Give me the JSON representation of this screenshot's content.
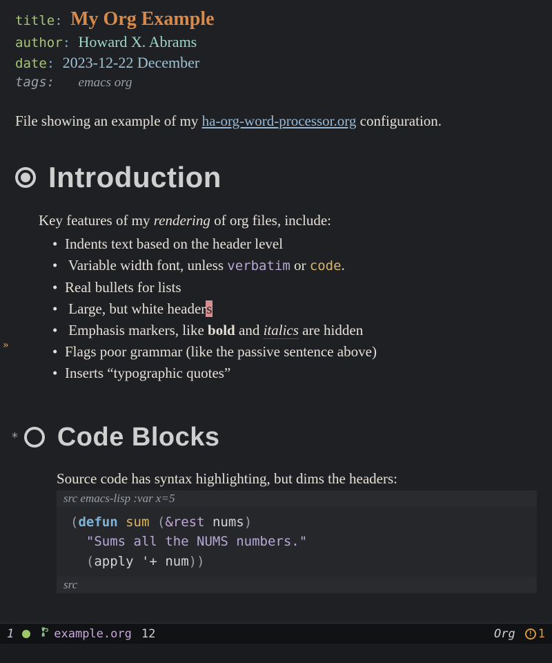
{
  "meta": {
    "title_key": "title",
    "title_val": "My Org Example",
    "author_key": "author",
    "author_val": "Howard X. Abrams",
    "date_key": "date",
    "date_val": "2023-12-22 December",
    "tags_key": "tags:",
    "tags_val": "emacs org"
  },
  "intro": {
    "pre": "File showing an example of my ",
    "link": "ha-org-word-processor.org",
    "post": " configuration."
  },
  "h1a": "Introduction",
  "lead": {
    "pre": "Key features of my ",
    "em": "rendering",
    "post": " of org files, include:"
  },
  "features": {
    "f0": "Indents text based on the header level",
    "f1_pre": "Variable width font, unless ",
    "f1_verbatim": "verbatim",
    "f1_mid": " or ",
    "f1_code": "code",
    "f1_post": ".",
    "f2": "Real bullets for lists",
    "f3_pre": "Large, but white header",
    "f3_cursor": "s",
    "f4_pre": "Emphasis markers, like ",
    "f4_bold": "bold",
    "f4_mid": " and ",
    "f4_ital": "italics",
    "f4_post": " are hidden",
    "f5": "Flags poor grammar (like the passive sentence above)",
    "f6": "Inserts “typographic quotes”"
  },
  "h1b_star": "*",
  "h1b": "Code Blocks",
  "code_intro": "Source code has syntax highlighting, but dims the headers:",
  "src": {
    "header_prefix": "src ",
    "header_lang": "emacs-lisp :var x=5",
    "l1_open": "(",
    "l1_kw": "defun",
    "l1_sp": " ",
    "l1_fn": "sum",
    "l1_sp2": " (",
    "l1_amp": "&rest",
    "l1_sp3": " ",
    "l1_arg": "nums",
    "l1_close": ")",
    "l2_str": "\"Sums all the NUMS numbers.\"",
    "l3_open": "(",
    "l3_fn": "apply",
    "l3_mid": " '+ ",
    "l3_arg": "num",
    "l3_close": "))",
    "footer": "src"
  },
  "modeline": {
    "win": "1",
    "file": "example.org",
    "line": "12",
    "mode": "Org",
    "warn_bang": "!",
    "warn_count": "1"
  },
  "fringe": "»"
}
